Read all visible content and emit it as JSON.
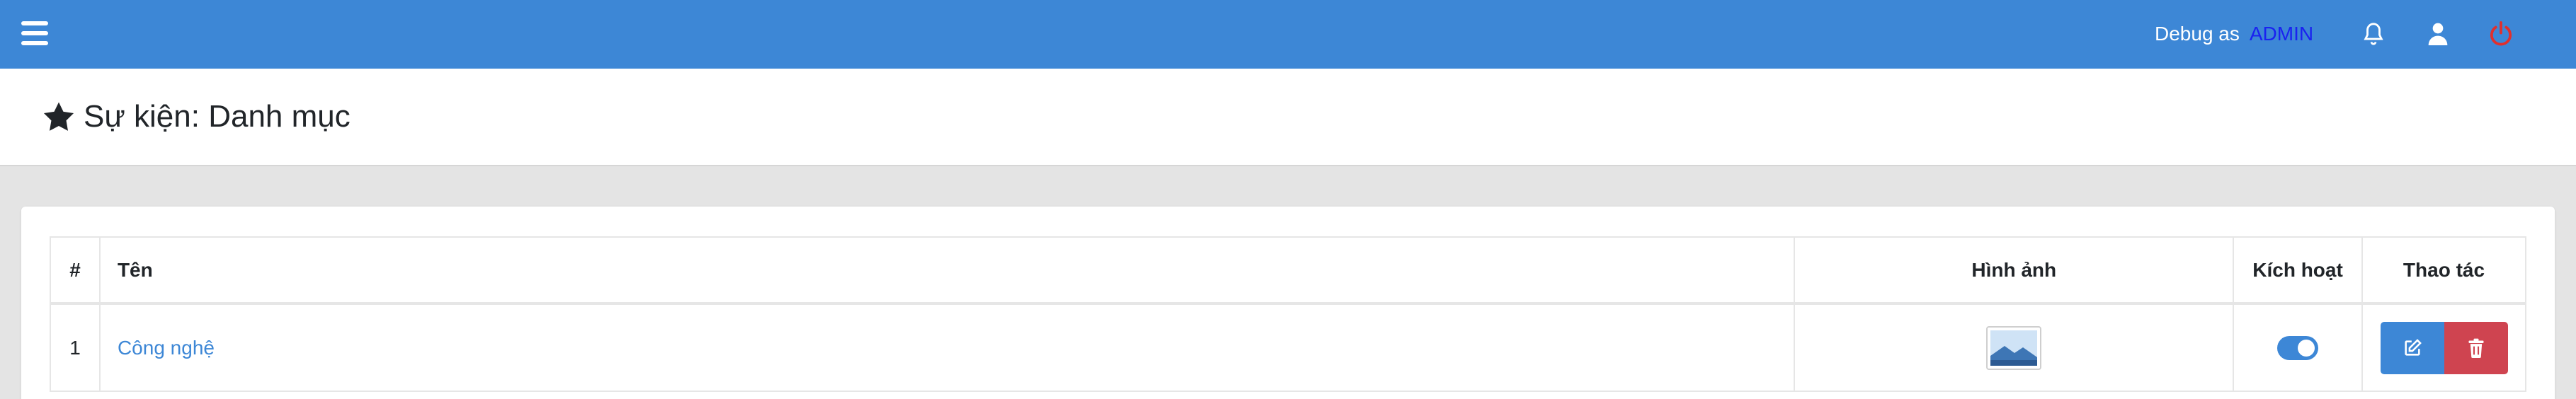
{
  "topbar": {
    "debug_label": "Debug as",
    "debug_role": "ADMIN",
    "icons": [
      "menu-icon",
      "bell-icon",
      "user-icon",
      "power-icon"
    ],
    "colors": {
      "bar": "#3d87d6",
      "role": "#1a22f0",
      "power": "#e0302e"
    }
  },
  "page": {
    "title": "Sự kiện: Danh mục",
    "title_icon": "star-icon"
  },
  "table": {
    "headers": {
      "num": "#",
      "name": "Tên",
      "image": "Hình ảnh",
      "active": "Kích hoạt",
      "actions": "Thao tác"
    },
    "rows": [
      {
        "num": "1",
        "name": "Công nghệ",
        "image": "image-placeholder-icon",
        "active": true,
        "actions": [
          "edit-icon",
          "trash-icon"
        ]
      }
    ]
  }
}
